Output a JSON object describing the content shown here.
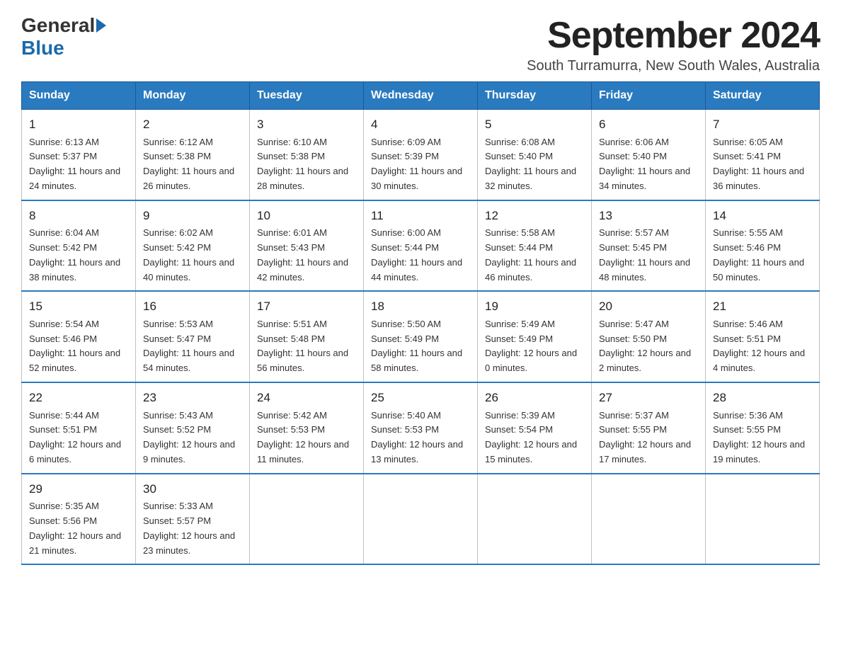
{
  "logo": {
    "general": "General",
    "blue": "Blue"
  },
  "title": "September 2024",
  "subtitle": "South Turramurra, New South Wales, Australia",
  "days_header": [
    "Sunday",
    "Monday",
    "Tuesday",
    "Wednesday",
    "Thursday",
    "Friday",
    "Saturday"
  ],
  "weeks": [
    [
      {
        "day": "1",
        "sunrise": "6:13 AM",
        "sunset": "5:37 PM",
        "daylight": "11 hours and 24 minutes."
      },
      {
        "day": "2",
        "sunrise": "6:12 AM",
        "sunset": "5:38 PM",
        "daylight": "11 hours and 26 minutes."
      },
      {
        "day": "3",
        "sunrise": "6:10 AM",
        "sunset": "5:38 PM",
        "daylight": "11 hours and 28 minutes."
      },
      {
        "day": "4",
        "sunrise": "6:09 AM",
        "sunset": "5:39 PM",
        "daylight": "11 hours and 30 minutes."
      },
      {
        "day": "5",
        "sunrise": "6:08 AM",
        "sunset": "5:40 PM",
        "daylight": "11 hours and 32 minutes."
      },
      {
        "day": "6",
        "sunrise": "6:06 AM",
        "sunset": "5:40 PM",
        "daylight": "11 hours and 34 minutes."
      },
      {
        "day": "7",
        "sunrise": "6:05 AM",
        "sunset": "5:41 PM",
        "daylight": "11 hours and 36 minutes."
      }
    ],
    [
      {
        "day": "8",
        "sunrise": "6:04 AM",
        "sunset": "5:42 PM",
        "daylight": "11 hours and 38 minutes."
      },
      {
        "day": "9",
        "sunrise": "6:02 AM",
        "sunset": "5:42 PM",
        "daylight": "11 hours and 40 minutes."
      },
      {
        "day": "10",
        "sunrise": "6:01 AM",
        "sunset": "5:43 PM",
        "daylight": "11 hours and 42 minutes."
      },
      {
        "day": "11",
        "sunrise": "6:00 AM",
        "sunset": "5:44 PM",
        "daylight": "11 hours and 44 minutes."
      },
      {
        "day": "12",
        "sunrise": "5:58 AM",
        "sunset": "5:44 PM",
        "daylight": "11 hours and 46 minutes."
      },
      {
        "day": "13",
        "sunrise": "5:57 AM",
        "sunset": "5:45 PM",
        "daylight": "11 hours and 48 minutes."
      },
      {
        "day": "14",
        "sunrise": "5:55 AM",
        "sunset": "5:46 PM",
        "daylight": "11 hours and 50 minutes."
      }
    ],
    [
      {
        "day": "15",
        "sunrise": "5:54 AM",
        "sunset": "5:46 PM",
        "daylight": "11 hours and 52 minutes."
      },
      {
        "day": "16",
        "sunrise": "5:53 AM",
        "sunset": "5:47 PM",
        "daylight": "11 hours and 54 minutes."
      },
      {
        "day": "17",
        "sunrise": "5:51 AM",
        "sunset": "5:48 PM",
        "daylight": "11 hours and 56 minutes."
      },
      {
        "day": "18",
        "sunrise": "5:50 AM",
        "sunset": "5:49 PM",
        "daylight": "11 hours and 58 minutes."
      },
      {
        "day": "19",
        "sunrise": "5:49 AM",
        "sunset": "5:49 PM",
        "daylight": "12 hours and 0 minutes."
      },
      {
        "day": "20",
        "sunrise": "5:47 AM",
        "sunset": "5:50 PM",
        "daylight": "12 hours and 2 minutes."
      },
      {
        "day": "21",
        "sunrise": "5:46 AM",
        "sunset": "5:51 PM",
        "daylight": "12 hours and 4 minutes."
      }
    ],
    [
      {
        "day": "22",
        "sunrise": "5:44 AM",
        "sunset": "5:51 PM",
        "daylight": "12 hours and 6 minutes."
      },
      {
        "day": "23",
        "sunrise": "5:43 AM",
        "sunset": "5:52 PM",
        "daylight": "12 hours and 9 minutes."
      },
      {
        "day": "24",
        "sunrise": "5:42 AM",
        "sunset": "5:53 PM",
        "daylight": "12 hours and 11 minutes."
      },
      {
        "day": "25",
        "sunrise": "5:40 AM",
        "sunset": "5:53 PM",
        "daylight": "12 hours and 13 minutes."
      },
      {
        "day": "26",
        "sunrise": "5:39 AM",
        "sunset": "5:54 PM",
        "daylight": "12 hours and 15 minutes."
      },
      {
        "day": "27",
        "sunrise": "5:37 AM",
        "sunset": "5:55 PM",
        "daylight": "12 hours and 17 minutes."
      },
      {
        "day": "28",
        "sunrise": "5:36 AM",
        "sunset": "5:55 PM",
        "daylight": "12 hours and 19 minutes."
      }
    ],
    [
      {
        "day": "29",
        "sunrise": "5:35 AM",
        "sunset": "5:56 PM",
        "daylight": "12 hours and 21 minutes."
      },
      {
        "day": "30",
        "sunrise": "5:33 AM",
        "sunset": "5:57 PM",
        "daylight": "12 hours and 23 minutes."
      },
      null,
      null,
      null,
      null,
      null
    ]
  ]
}
